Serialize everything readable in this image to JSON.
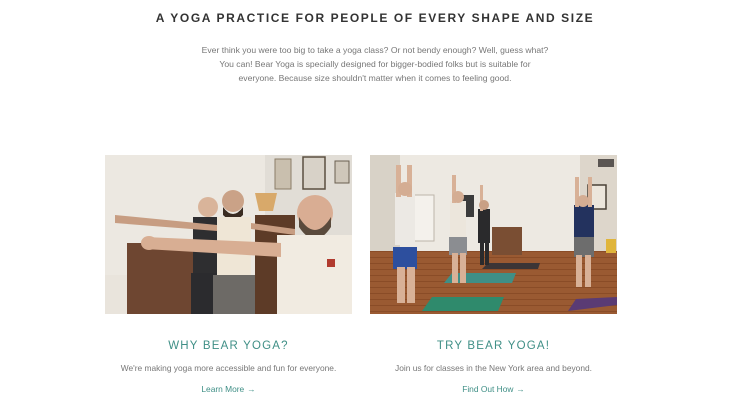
{
  "hero": {
    "title": "A YOGA PRACTICE FOR PEOPLE OF EVERY SHAPE AND SIZE",
    "intro": "Ever think you were too big to take a yoga class? Or not bendy enough? Well, guess what? You can! Bear Yoga is specially designed for bigger-bodied folks but is suitable for everyone. Because size shouldn't matter when it comes to feeling good."
  },
  "cards": [
    {
      "heading": "WHY BEAR YOGA?",
      "text": "We're making yoga more accessible and fun for everyone.",
      "link": "Learn More",
      "arrow": "→"
    },
    {
      "heading": "TRY BEAR YOGA!",
      "text": "Join us for classes in the New York area and beyond.",
      "link": "Find Out How",
      "arrow": "→"
    }
  ],
  "colors": {
    "accent": "#3f8f86",
    "text": "#777777",
    "title": "#333333"
  }
}
